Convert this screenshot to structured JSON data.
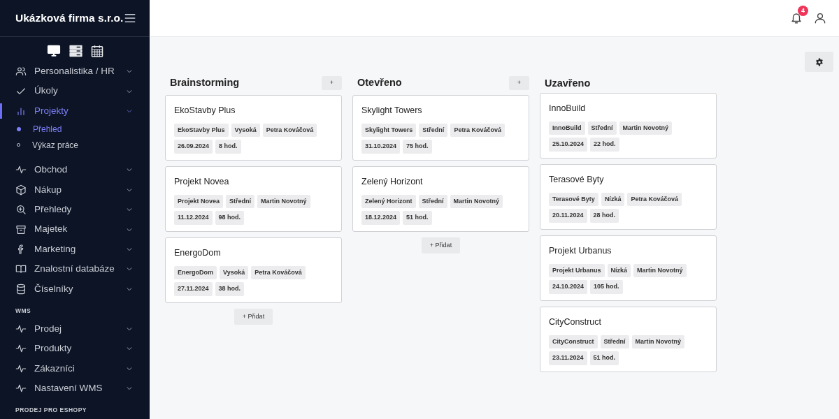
{
  "sidebar": {
    "brand": "Ukázková firma s.r.o.",
    "sections": [
      {
        "items": [
          {
            "label": "Personalistika / HR",
            "selected": false
          },
          {
            "label": "Úkoly",
            "selected": false
          },
          {
            "label": "Projekty",
            "selected": true,
            "children": [
              {
                "label": "Přehled",
                "selected": true
              },
              {
                "label": "Výkaz práce",
                "selected": false
              }
            ]
          },
          {
            "label": "Obchod",
            "selected": false
          },
          {
            "label": "Nákup",
            "selected": false
          },
          {
            "label": "Přehledy",
            "selected": false
          },
          {
            "label": "Majetek",
            "selected": false
          },
          {
            "label": "Marketing",
            "selected": false
          },
          {
            "label": "Znalostní databáze",
            "selected": false
          },
          {
            "label": "Číselníky",
            "selected": false
          }
        ]
      },
      {
        "heading": "WMS",
        "items": [
          {
            "label": "Prodej",
            "selected": false
          },
          {
            "label": "Produkty",
            "selected": false
          },
          {
            "label": "Zákazníci",
            "selected": false
          },
          {
            "label": "Nastavení WMS",
            "selected": false
          }
        ]
      },
      {
        "heading": "PRODEJ PRO ESHOPY"
      }
    ]
  },
  "topbar": {
    "notifications": "4"
  },
  "board": {
    "columns": [
      {
        "title": "Brainstorming",
        "add_button": "+",
        "footer_button": "+ Přidat",
        "cards": [
          {
            "title": "EkoStavby Plus",
            "tags": [
              "EkoStavby Plus",
              "Vysoká",
              "Petra Kováčová"
            ],
            "details": [
              "26.09.2024",
              "8 hod."
            ]
          },
          {
            "title": "Projekt Novea",
            "tags": [
              "Projekt Novea",
              "Střední",
              "Martin Novotný"
            ],
            "details": [
              "11.12.2024",
              "98 hod."
            ]
          },
          {
            "title": "EnergoDom",
            "tags": [
              "EnergoDom",
              "Vysoká",
              "Petra Kováčová"
            ],
            "details": [
              "27.11.2024",
              "38 hod."
            ]
          }
        ]
      },
      {
        "title": "Otevřeno",
        "add_button": "+",
        "footer_button": "+ Přidat",
        "cards": [
          {
            "title": "Skylight Towers",
            "tags": [
              "Skylight Towers",
              "Střední",
              "Petra Kováčová"
            ],
            "details": [
              "31.10.2024",
              "75 hod."
            ]
          },
          {
            "title": "Zelený Horizont",
            "tags": [
              "Zelený Horizont",
              "Střední",
              "Martin Novotný"
            ],
            "details": [
              "18.12.2024",
              "51 hod."
            ]
          }
        ]
      },
      {
        "title": "Uzavřeno",
        "cards": [
          {
            "title": "InnoBuild",
            "tags": [
              "InnoBuild",
              "Střední",
              "Martin Novotný"
            ],
            "details": [
              "25.10.2024",
              "22 hod."
            ]
          },
          {
            "title": "Terasové Byty",
            "tags": [
              "Terasové Byty",
              "Nízká",
              "Petra Kováčová"
            ],
            "details": [
              "20.11.2024",
              "28 hod."
            ]
          },
          {
            "title": "Projekt Urbanus",
            "tags": [
              "Projekt Urbanus",
              "Nízká",
              "Martin Novotný"
            ],
            "details": [
              "24.10.2024",
              "105 hod."
            ]
          },
          {
            "title": "CityConstruct",
            "tags": [
              "CityConstruct",
              "Střední",
              "Martin Novotný"
            ],
            "details": [
              "23.11.2024",
              "51 hod."
            ]
          }
        ]
      }
    ]
  }
}
